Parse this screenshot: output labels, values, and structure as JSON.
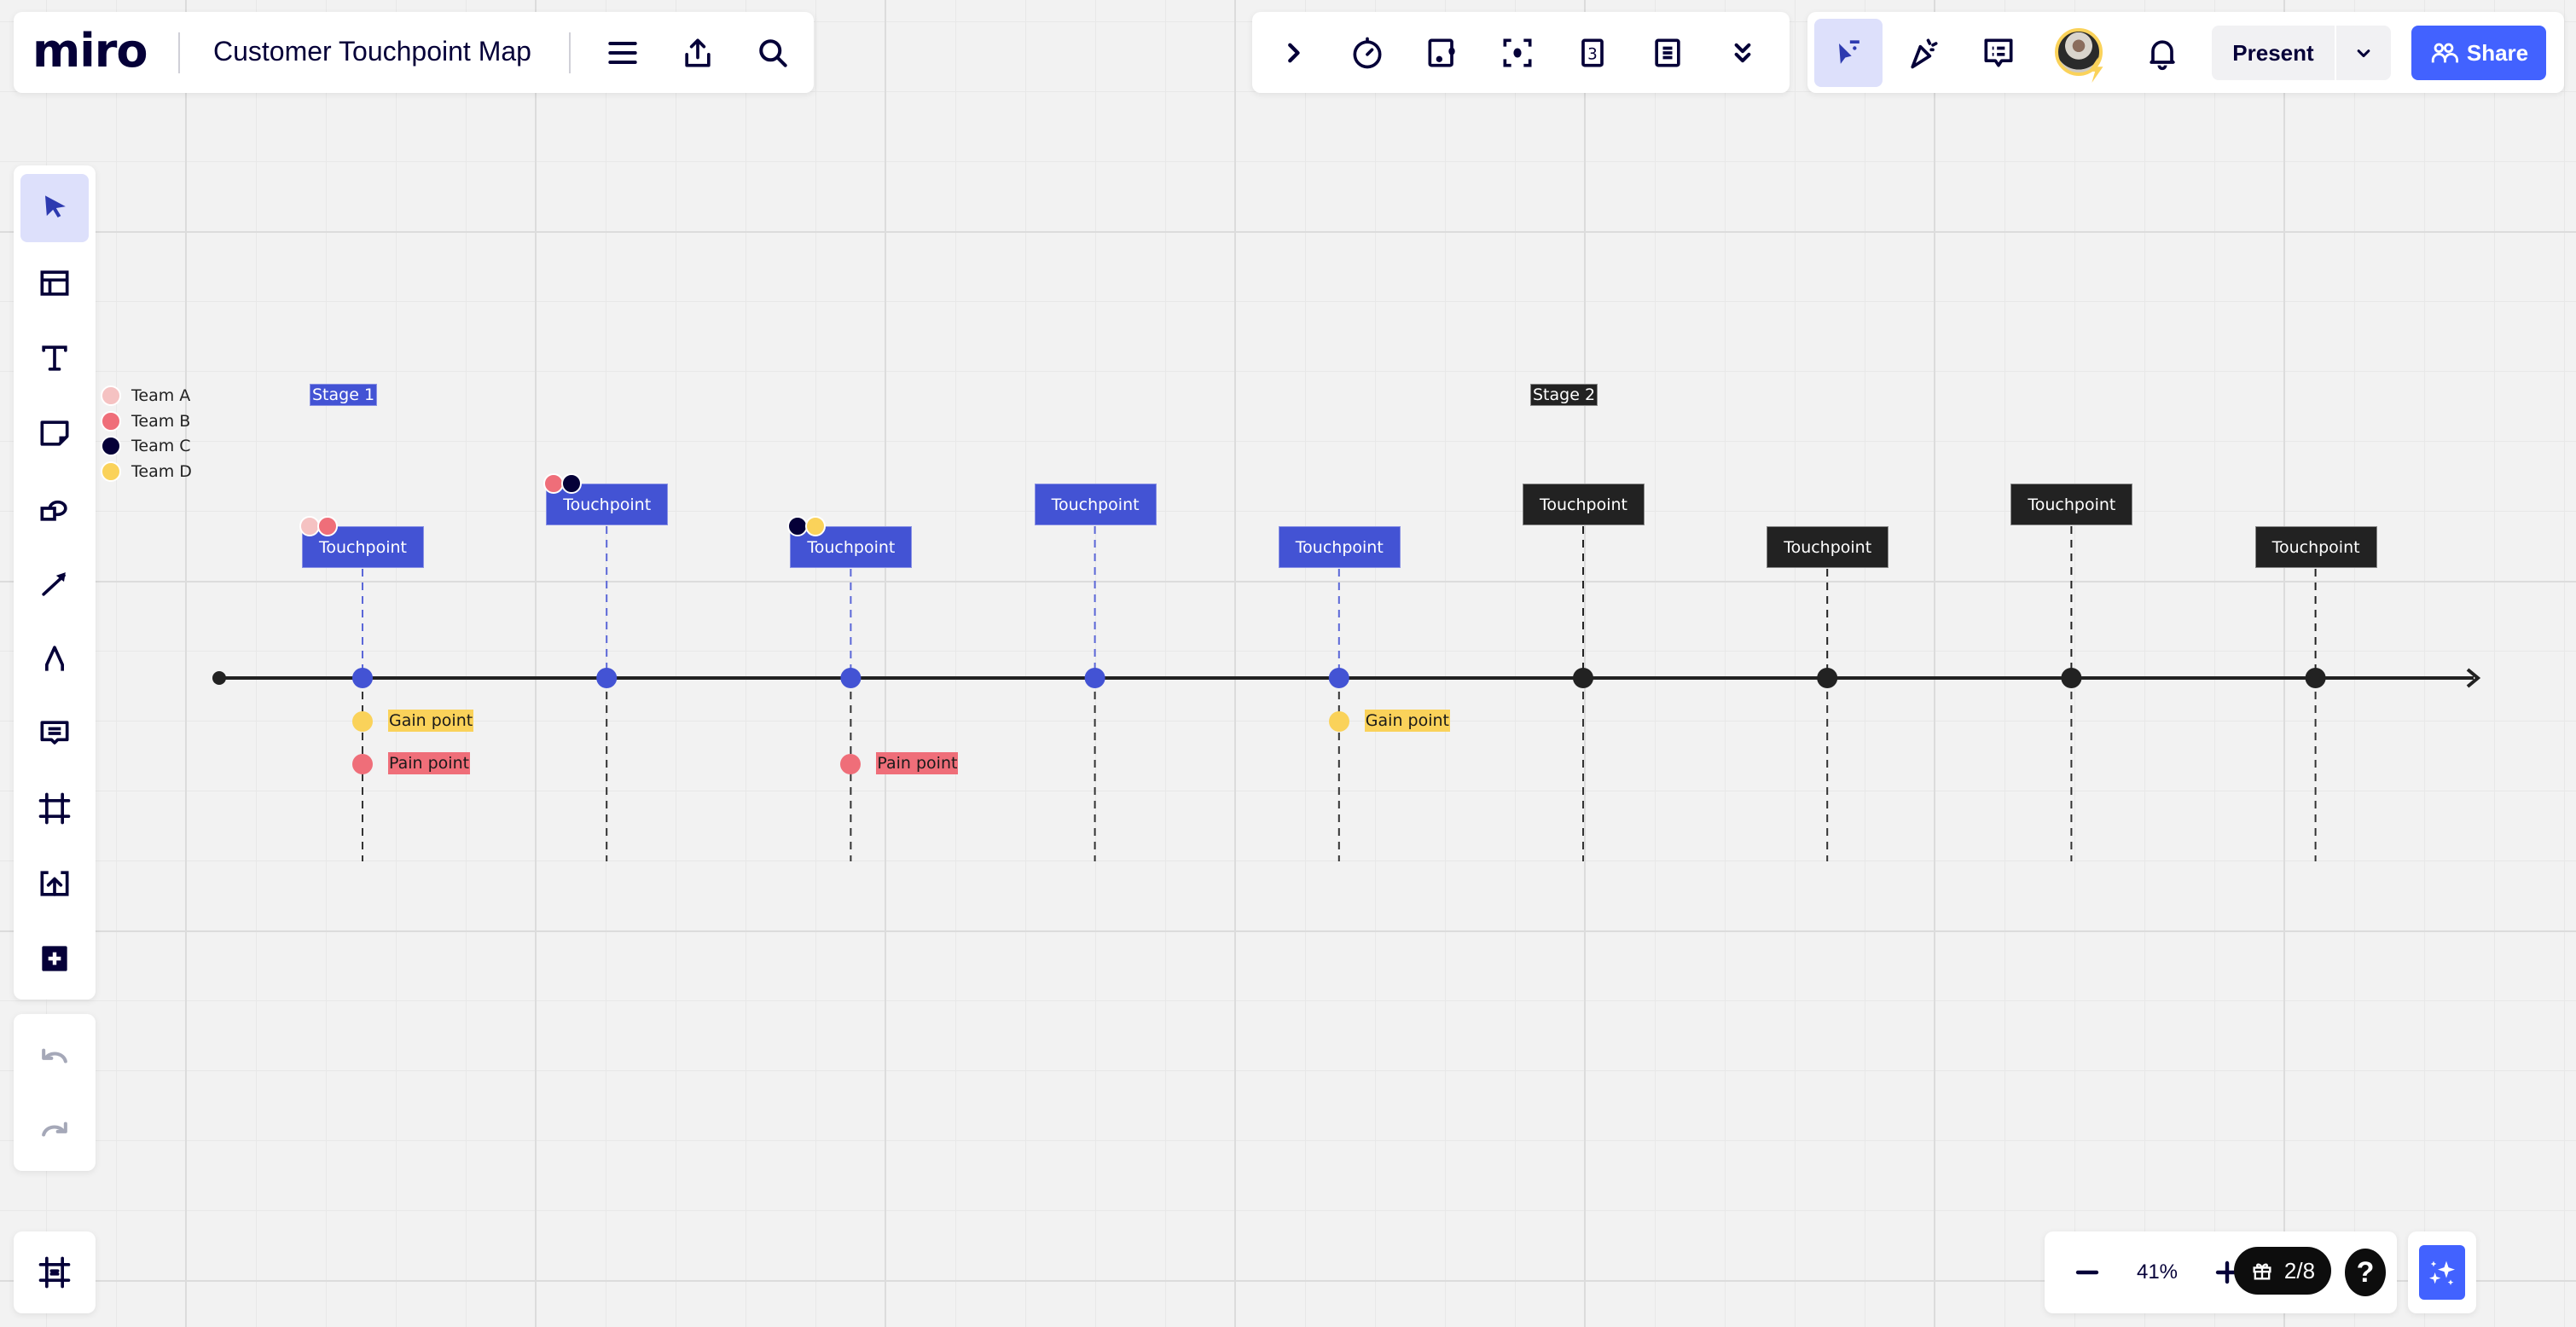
{
  "app": {
    "logo": "miro",
    "board_title": "Customer Touchpoint Map"
  },
  "top_left_toolbar": {
    "icons": [
      "menu-icon",
      "export-icon",
      "search-icon"
    ]
  },
  "top_center_toolbar": {
    "icons": [
      "expand-chevron-icon",
      "timer-icon",
      "card-icon",
      "focus-icon",
      "count-card-icon",
      "notes-icon",
      "more-chevrons-icon"
    ]
  },
  "top_right_toolbar": {
    "present_label": "Present",
    "share_label": "Share",
    "icons": [
      "cursor-follow-icon",
      "celebrate-icon",
      "comments-list-icon",
      "avatar",
      "bell-icon"
    ]
  },
  "left_toolbar": {
    "tools": [
      {
        "name": "select",
        "active": true
      },
      {
        "name": "templates"
      },
      {
        "name": "text"
      },
      {
        "name": "sticky-note"
      },
      {
        "name": "shapes"
      },
      {
        "name": "connection-line"
      },
      {
        "name": "pen"
      },
      {
        "name": "comment"
      },
      {
        "name": "frame"
      },
      {
        "name": "upload"
      },
      {
        "name": "more-apps"
      }
    ]
  },
  "history": {
    "undo": "undo",
    "redo": "redo"
  },
  "zoom_controls": {
    "zoom_level": "41%",
    "gift_count": "2/8",
    "help": "?"
  },
  "colors": {
    "accent": "#4262ff",
    "touchpoint_stage1": "#4353d4",
    "touchpoint_stage2": "#222222",
    "team_a": "#f5c2c2",
    "team_b": "#ef6e79",
    "team_c": "#050038",
    "team_d": "#fad25a"
  },
  "legend": [
    {
      "label": "Team A",
      "color": "#f5c2c2"
    },
    {
      "label": "Team B",
      "color": "#ef6e79"
    },
    {
      "label": "Team C",
      "color": "#050038"
    },
    {
      "label": "Team D",
      "color": "#fad25a"
    }
  ],
  "stages": [
    {
      "label": "Stage 1",
      "theme": "blue"
    },
    {
      "label": "Stage 2",
      "theme": "dark"
    }
  ],
  "touchpoints": [
    {
      "label": "Touchpoint",
      "stage": 1,
      "row": "low",
      "teams": [
        "#f5c2c2",
        "#ef6e79"
      ],
      "gain": "Gain point",
      "pain": "Pain point"
    },
    {
      "label": "Touchpoint",
      "stage": 1,
      "row": "high",
      "teams": [
        "#ef6e79",
        "#050038"
      ]
    },
    {
      "label": "Touchpoint",
      "stage": 1,
      "row": "low",
      "teams": [
        "#050038",
        "#fad25a"
      ],
      "pain": "Pain point"
    },
    {
      "label": "Touchpoint",
      "stage": 1,
      "row": "high",
      "teams": []
    },
    {
      "label": "Touchpoint",
      "stage": 1,
      "row": "low",
      "teams": [],
      "gain": "Gain point"
    },
    {
      "label": "Touchpoint",
      "stage": 2,
      "row": "high",
      "teams": []
    },
    {
      "label": "Touchpoint",
      "stage": 2,
      "row": "low",
      "teams": []
    },
    {
      "label": "Touchpoint",
      "stage": 2,
      "row": "high",
      "teams": []
    },
    {
      "label": "Touchpoint",
      "stage": 2,
      "row": "low",
      "teams": []
    }
  ]
}
